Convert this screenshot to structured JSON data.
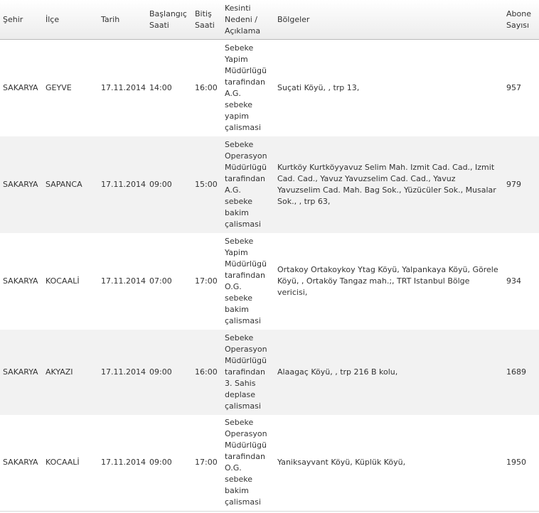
{
  "headers": {
    "city": "Şehir",
    "district": "İlçe",
    "date": "Tarih",
    "start": "Başlangıç\nSaati",
    "end": "Bitiş\nSaati",
    "reason": "Kesinti\nNedeni /\nAçıklama",
    "regions": "Bölgeler",
    "subscribers": "Abone\nSayısı"
  },
  "rows": [
    {
      "city": "SAKARYA",
      "district": "GEYVE",
      "date": "17.11.2014",
      "start": "14:00",
      "end": "16:00",
      "reason": "Sebeke\nYapim\nMüdürlügü\ntarafindan\nA.G.\nsebeke\nyapim\nçalismasi",
      "regions": "Suçati Köyü, , trp 13,",
      "subscribers": "957"
    },
    {
      "city": "SAKARYA",
      "district": "SAPANCA",
      "date": "17.11.2014",
      "start": "09:00",
      "end": "15:00",
      "reason": "Sebeke\nOperasyon\nMüdürlügü\ntarafindan\nA.G.\nsebeke\nbakim\nçalismasi",
      "regions": "Kurtköy Kurtköyyavuz Selim Mah. Izmit Cad. Cad., Izmit Cad. Cad., Yavuz Yavuzselim Cad. Cad., Yavuz Yavuzselim Cad. Mah. Bag Sok., Yüzücüler Sok., Musalar Sok., , trp 63,",
      "subscribers": "979"
    },
    {
      "city": "SAKARYA",
      "district": "KOCAALİ",
      "date": "17.11.2014",
      "start": "07:00",
      "end": "17:00",
      "reason": "Sebeke\nYapim\nMüdürlügü\ntarafindan\nO.G.\nsebeke\nbakim\nçalismasi",
      "regions": "Ortakoy Ortakoykoy Ytag Köyü, Yalpankaya Köyü, Görele Köyü, , Ortaköy Tangaz mah.;, TRT Istanbul Bölge vericisi,",
      "subscribers": "934"
    },
    {
      "city": "SAKARYA",
      "district": "AKYAZI",
      "date": "17.11.2014",
      "start": "09:00",
      "end": "16:00",
      "reason": "Sebeke\nOperasyon\nMüdürlügü\ntarafindan\n3. Sahis\ndeplase\nçalismasi",
      "regions": "Alaagaç Köyü, , trp 216 B kolu,",
      "subscribers": "1689"
    },
    {
      "city": "SAKARYA",
      "district": "KOCAALİ",
      "date": "17.11.2014",
      "start": "09:00",
      "end": "17:00",
      "reason": "Sebeke\nOperasyon\nMüdürlügü\ntarafindan\nO.G.\nsebeke\nbakim\nçalismasi",
      "regions": "Yaniksayvant Köyü, Küplük Köyü,",
      "subscribers": "1950"
    }
  ]
}
